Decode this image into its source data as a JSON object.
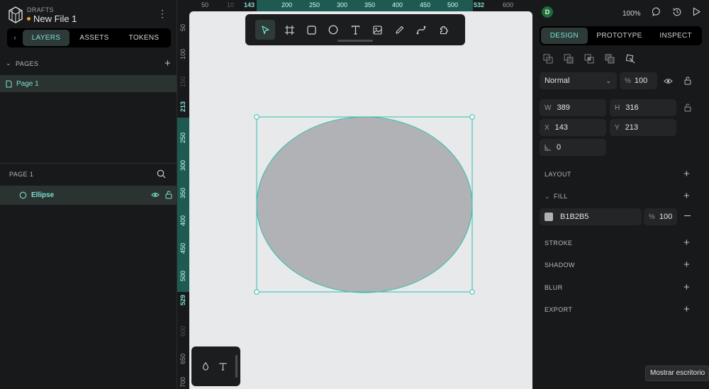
{
  "header": {
    "section": "DRAFTS",
    "filename": "New File 1"
  },
  "left_tabs": [
    "LAYERS",
    "ASSETS",
    "TOKENS"
  ],
  "pages": {
    "title": "PAGES",
    "items": [
      "Page 1"
    ]
  },
  "layers": {
    "page_title": "PAGE 1",
    "items": [
      "Ellipse"
    ]
  },
  "ruler_top": [
    "50",
    "10",
    "143",
    "200",
    "250",
    "300",
    "350",
    "400",
    "450",
    "500",
    "532",
    "600"
  ],
  "ruler_left": [
    "50",
    "100",
    "150",
    "213",
    "250",
    "300",
    "350",
    "400",
    "450",
    "500",
    "529",
    "600",
    "650",
    "700"
  ],
  "toolbar_tools": [
    "pointer-icon",
    "board-icon",
    "rectangle-icon",
    "ellipse-icon",
    "text-icon",
    "image-icon",
    "pencil-icon",
    "path-icon",
    "plugin-icon"
  ],
  "right_header": {
    "avatar": "D",
    "zoom": "100%"
  },
  "right_tabs": [
    "DESIGN",
    "PROTOTYPE",
    "INSPECT"
  ],
  "layer_props": {
    "blend": "Normal",
    "opacity_label": "%",
    "opacity": "100"
  },
  "measures": {
    "w_label": "W",
    "w": "389",
    "h_label": "H",
    "h": "316",
    "x_label": "X",
    "x": "143",
    "y_label": "Y",
    "y": "213",
    "rotation": "0"
  },
  "sections": {
    "layout": "LAYOUT",
    "fill": "FILL",
    "stroke": "STROKE",
    "shadow": "SHADOW",
    "blur": "BLUR",
    "export": "EXPORT"
  },
  "fill": {
    "hex": "B1B2B5",
    "opacity_label": "%",
    "opacity": "100",
    "color": "#B1B2B5"
  },
  "colors": {
    "accent": "#7de0d4",
    "selection": "#31c0b0",
    "ellipse": "#b1b2b5",
    "canvas": "#e8e9ea"
  },
  "tooltip": "Mostrar escritorio"
}
